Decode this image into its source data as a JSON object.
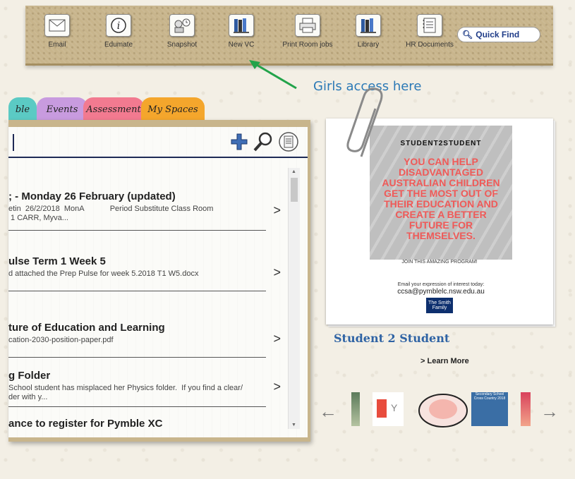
{
  "toolbar": {
    "items": [
      {
        "label": "Email",
        "icon": "envelope-icon"
      },
      {
        "label": "Edumate",
        "icon": "info-icon"
      },
      {
        "label": "Snapshot",
        "icon": "snapshot-icon"
      },
      {
        "label": "New VC",
        "icon": "books-icon"
      },
      {
        "label": "Print Room jobs",
        "icon": "printer-icon"
      },
      {
        "label": "Library",
        "icon": "library-icon"
      },
      {
        "label": "HR Documents",
        "icon": "documents-icon"
      }
    ],
    "quick_find": "Quick Find"
  },
  "annotation": {
    "text": "Girls access here",
    "color": "#2b79b6",
    "arrow_color": "#22a34a"
  },
  "tabs": [
    {
      "label": "ble",
      "color": "#5bcac4"
    },
    {
      "label": "Events",
      "color": "#c89bdf"
    },
    {
      "label": "Assessment",
      "color": "#f27a90"
    },
    {
      "label": "My Spaces",
      "color": "#f4a62c"
    }
  ],
  "notices": [
    {
      "title": "; - Monday 26 February (updated)",
      "desc": "etin  26/2/2018  MonA            Period Substitute Class Room\n 1 CARR, Myva..."
    },
    {
      "title": "ulse Term 1 Week 5",
      "desc": "d attached the Prep Pulse for week 5.2018 T1 W5.docx"
    },
    {
      "title": "ture of Education and Learning",
      "desc": "cation-2030-position-paper.pdf"
    },
    {
      "title": "g Folder",
      "desc": "School student has misplaced her Physics folder.  If you find a clear/\nder with y..."
    },
    {
      "title": "ance to register for Pymble XC",
      "desc": ""
    }
  ],
  "feature": {
    "poster_heading": "STUDENT2STUDENT",
    "poster_text": "YOU CAN HELP DISADVANTAGED AUSTRALIAN CHILDREN GET THE MOST OUT OF THEIR EDUCATION AND CREATE A BETTER FUTURE FOR THEMSELVES.",
    "poster_cta": "JOIN THIS AMAZING PROGRAM!",
    "poster_email_line": "Email your expression of interest today:",
    "poster_email": "ccsa@pymblelc.nsw.edu.au",
    "poster_logo": "The Smith Family",
    "title": "Student 2 Student",
    "learn_more": "> Learn More"
  },
  "carousel": {
    "thumbs": [
      {
        "name": "carousel-thumb-1",
        "color": "#5b7a5a"
      },
      {
        "name": "carousel-thumb-2",
        "color": "#e84c3d"
      },
      {
        "name": "carousel-thumb-3",
        "color": "#f4b6ae"
      },
      {
        "name": "carousel-thumb-4",
        "color": "#3a6ea5",
        "label": "Secondary School Cross Country 2018"
      },
      {
        "name": "carousel-thumb-5",
        "color": "#d9425c"
      }
    ]
  }
}
